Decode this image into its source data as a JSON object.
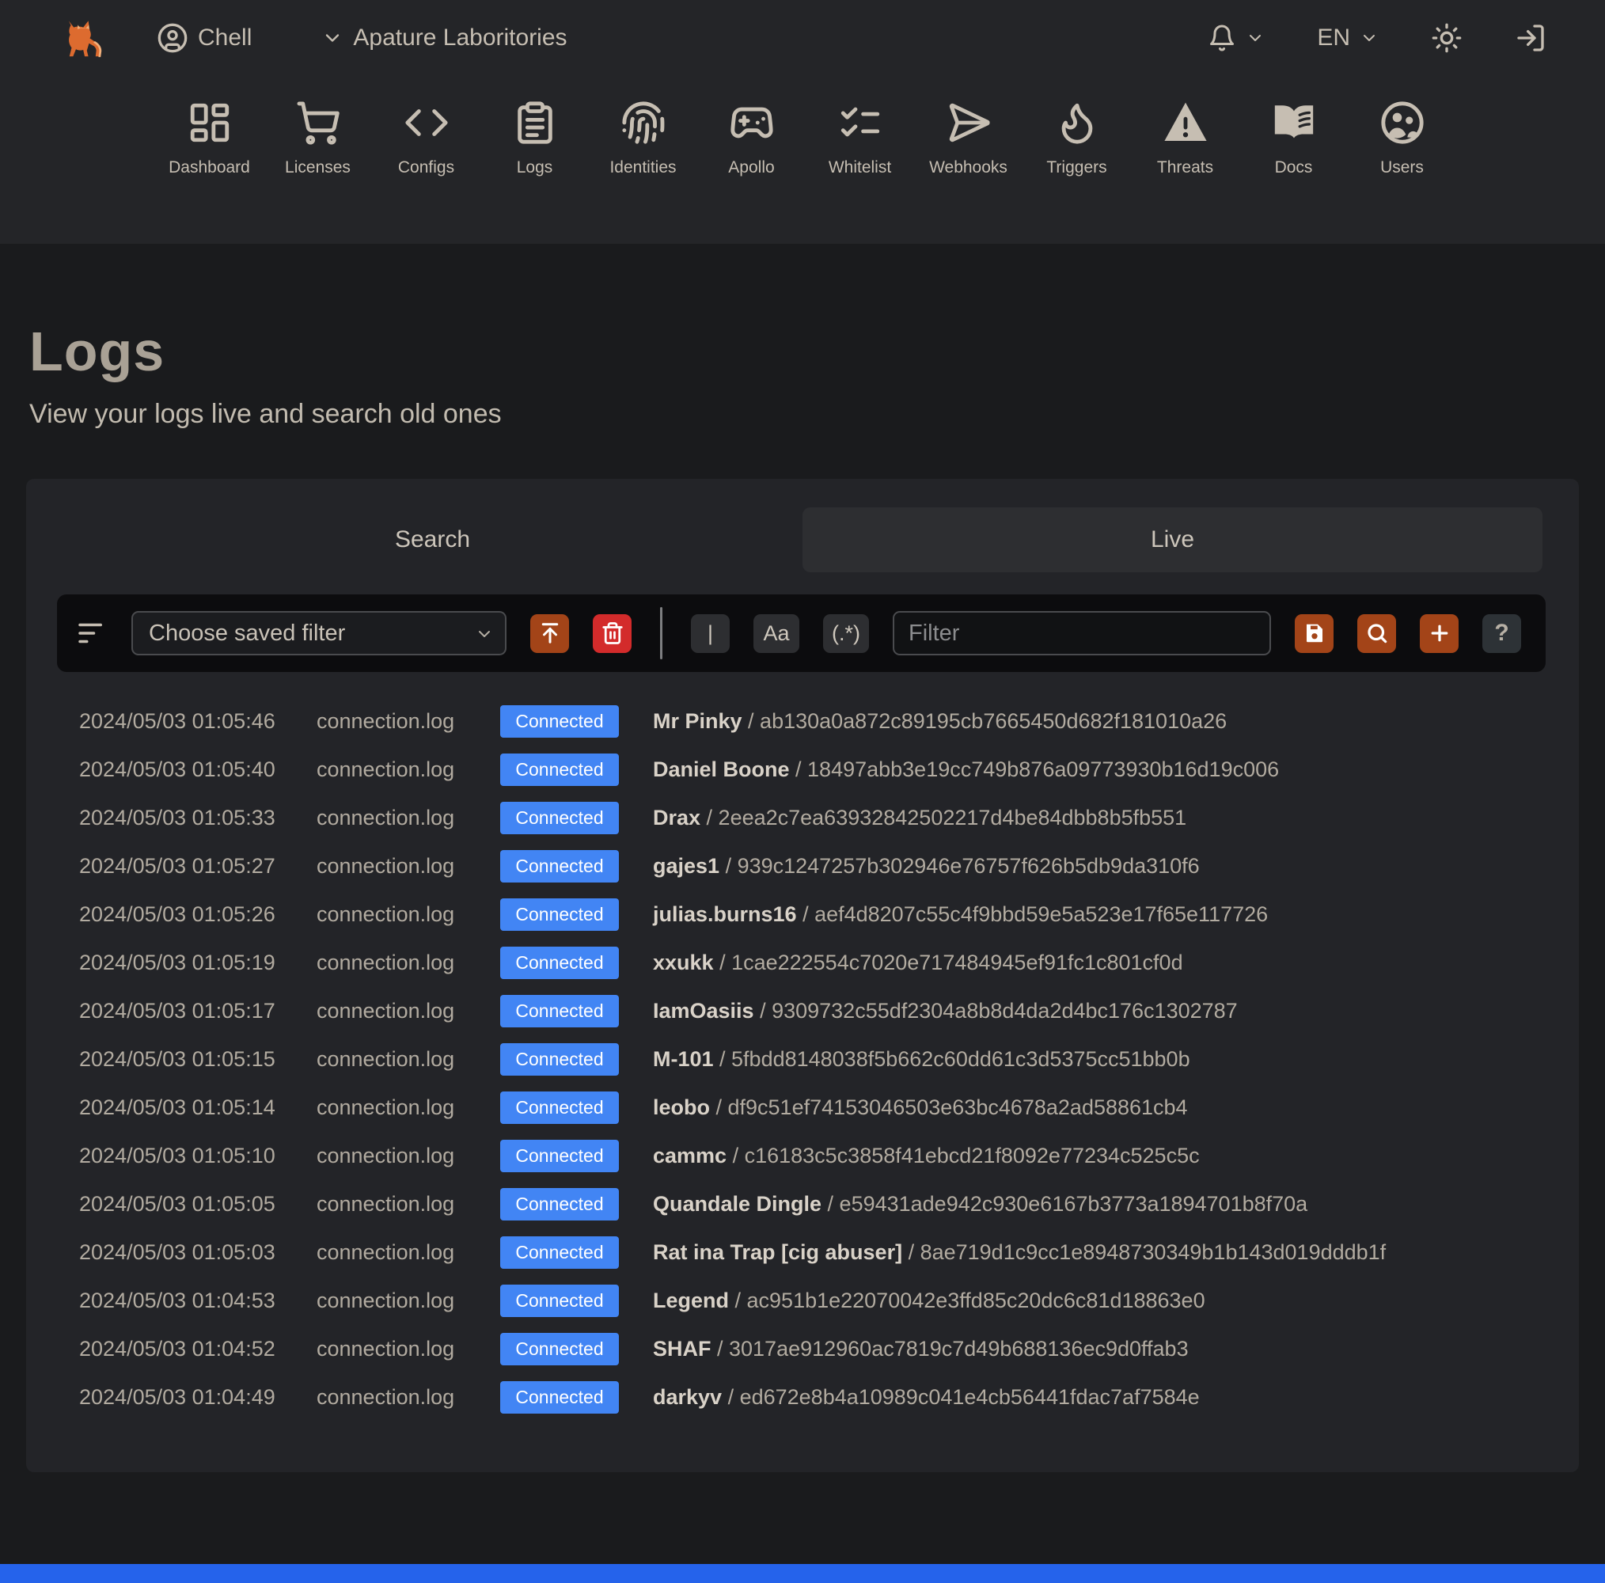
{
  "header": {
    "user": "Chell",
    "org": "Apature Laboritories",
    "lang": "EN"
  },
  "nav": {
    "items": [
      {
        "label": "Dashboard",
        "icon": "dashboard-icon"
      },
      {
        "label": "Licenses",
        "icon": "cart-icon"
      },
      {
        "label": "Configs",
        "icon": "code-icon"
      },
      {
        "label": "Logs",
        "icon": "clipboard-icon"
      },
      {
        "label": "Identities",
        "icon": "fingerprint-icon"
      },
      {
        "label": "Apollo",
        "icon": "gamepad-icon"
      },
      {
        "label": "Whitelist",
        "icon": "checklist-icon"
      },
      {
        "label": "Webhooks",
        "icon": "send-icon"
      },
      {
        "label": "Triggers",
        "icon": "flame-icon"
      },
      {
        "label": "Threats",
        "icon": "warning-icon"
      },
      {
        "label": "Docs",
        "icon": "book-icon"
      },
      {
        "label": "Users",
        "icon": "users-icon"
      }
    ]
  },
  "page": {
    "title": "Logs",
    "subtitle": "View your logs live and search old ones"
  },
  "tabs": {
    "search": "Search",
    "live": "Live"
  },
  "toolbar": {
    "saved_filter": "Choose saved filter",
    "filter_placeholder": "Filter",
    "toggles": {
      "pipe": "|",
      "case": "Aa",
      "regex": "(.*)"
    },
    "help": "?"
  },
  "logs": {
    "rows": [
      {
        "time": "2024/05/03 01:05:46",
        "file": "connection.log",
        "status": "Connected",
        "name": "Mr Pinky",
        "hash": "ab130a0a872c89195cb7665450d682f181010a26"
      },
      {
        "time": "2024/05/03 01:05:40",
        "file": "connection.log",
        "status": "Connected",
        "name": "Daniel Boone",
        "hash": "18497abb3e19cc749b876a09773930b16d19c006"
      },
      {
        "time": "2024/05/03 01:05:33",
        "file": "connection.log",
        "status": "Connected",
        "name": "Drax",
        "hash": "2eea2c7ea63932842502217d4be84dbb8b5fb551"
      },
      {
        "time": "2024/05/03 01:05:27",
        "file": "connection.log",
        "status": "Connected",
        "name": "gajes1",
        "hash": "939c1247257b302946e76757f626b5db9da310f6"
      },
      {
        "time": "2024/05/03 01:05:26",
        "file": "connection.log",
        "status": "Connected",
        "name": "julias.burns16",
        "hash": "aef4d8207c55c4f9bbd59e5a523e17f65e117726"
      },
      {
        "time": "2024/05/03 01:05:19",
        "file": "connection.log",
        "status": "Connected",
        "name": "xxukk",
        "hash": "1cae222554c7020e717484945ef91fc1c801cf0d"
      },
      {
        "time": "2024/05/03 01:05:17",
        "file": "connection.log",
        "status": "Connected",
        "name": "IamOasiis",
        "hash": "9309732c55df2304a8b8d4da2d4bc176c1302787"
      },
      {
        "time": "2024/05/03 01:05:15",
        "file": "connection.log",
        "status": "Connected",
        "name": "M-101",
        "hash": "5fbdd8148038f5b662c60dd61c3d5375cc51bb0b"
      },
      {
        "time": "2024/05/03 01:05:14",
        "file": "connection.log",
        "status": "Connected",
        "name": "leobo",
        "hash": "df9c51ef74153046503e63bc4678a2ad58861cb4"
      },
      {
        "time": "2024/05/03 01:05:10",
        "file": "connection.log",
        "status": "Connected",
        "name": "cammc",
        "hash": "c16183c5c3858f41ebcd21f8092e77234c525c5c"
      },
      {
        "time": "2024/05/03 01:05:05",
        "file": "connection.log",
        "status": "Connected",
        "name": "Quandale Dingle",
        "hash": "e59431ade942c930e6167b3773a1894701b8f70a"
      },
      {
        "time": "2024/05/03 01:05:03",
        "file": "connection.log",
        "status": "Connected",
        "name": "Rat ina Trap [cig abuser]",
        "hash": "8ae719d1c9cc1e8948730349b1b143d019dddb1f"
      },
      {
        "time": "2024/05/03 01:04:53",
        "file": "connection.log",
        "status": "Connected",
        "name": "Legend",
        "hash": "ac951b1e22070042e3ffd85c20dc6c81d18863e0"
      },
      {
        "time": "2024/05/03 01:04:52",
        "file": "connection.log",
        "status": "Connected",
        "name": "SHAF",
        "hash": "3017ae912960ac7819c7d49b688136ec9d0ffab3"
      },
      {
        "time": "2024/05/03 01:04:49",
        "file": "connection.log",
        "status": "Connected",
        "name": "darkyv",
        "hash": "ed672e8b4a10989c041e4cb56441fdac7af7584e"
      }
    ]
  },
  "colors": {
    "accent_orange": "#a34418",
    "danger_red": "#d32b2b",
    "badge_blue": "#4285f4",
    "bottom_bar_blue": "#2563eb",
    "header_bg": "#242528",
    "page_bg": "#1a1b1d",
    "panel_bg": "#232428"
  }
}
